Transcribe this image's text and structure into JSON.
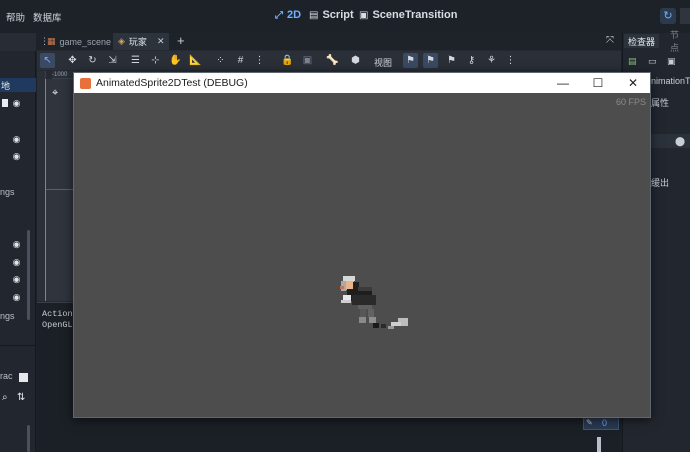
{
  "menu": {
    "help": "帮助",
    "database": "数据库"
  },
  "workspaces": [
    {
      "label": "2D",
      "icon": "2d-icon",
      "active": true
    },
    {
      "label": "Script",
      "icon": "script-icon",
      "active": false
    },
    {
      "label": "SceneTransition",
      "icon": "scene-transition-icon",
      "active": false
    }
  ],
  "scene_tabs": [
    {
      "label": "game_scene",
      "active": false
    },
    {
      "label": "玩家",
      "active": true
    }
  ],
  "toolbar": {
    "view_label": "视图"
  },
  "ruler": {
    "top_mark": "-1000"
  },
  "right_dock": {
    "tab_inspector": "检查器",
    "tab_node": "节点",
    "node_name_fragment": "nimationT",
    "attr_fragment": "属性",
    "easeout_fragment": "缓出",
    "value_zero": "0"
  },
  "left_dock": {
    "snippet_1": "ngs",
    "snippet_2": "ngs",
    "snippet_3": "rac",
    "snippet_top": "地"
  },
  "output": {
    "line1": "Action",
    "line2": "OpenGL"
  },
  "game_window": {
    "title": "AnimatedSprite2DTest (DEBUG)",
    "fps": "60 FPS",
    "minimize": "—",
    "maximize": "☐",
    "close": "✕"
  },
  "colors": {
    "accent": "#6fb0ff",
    "game_bg": "#4d4d4d",
    "editor_bg": "#1d2229"
  }
}
